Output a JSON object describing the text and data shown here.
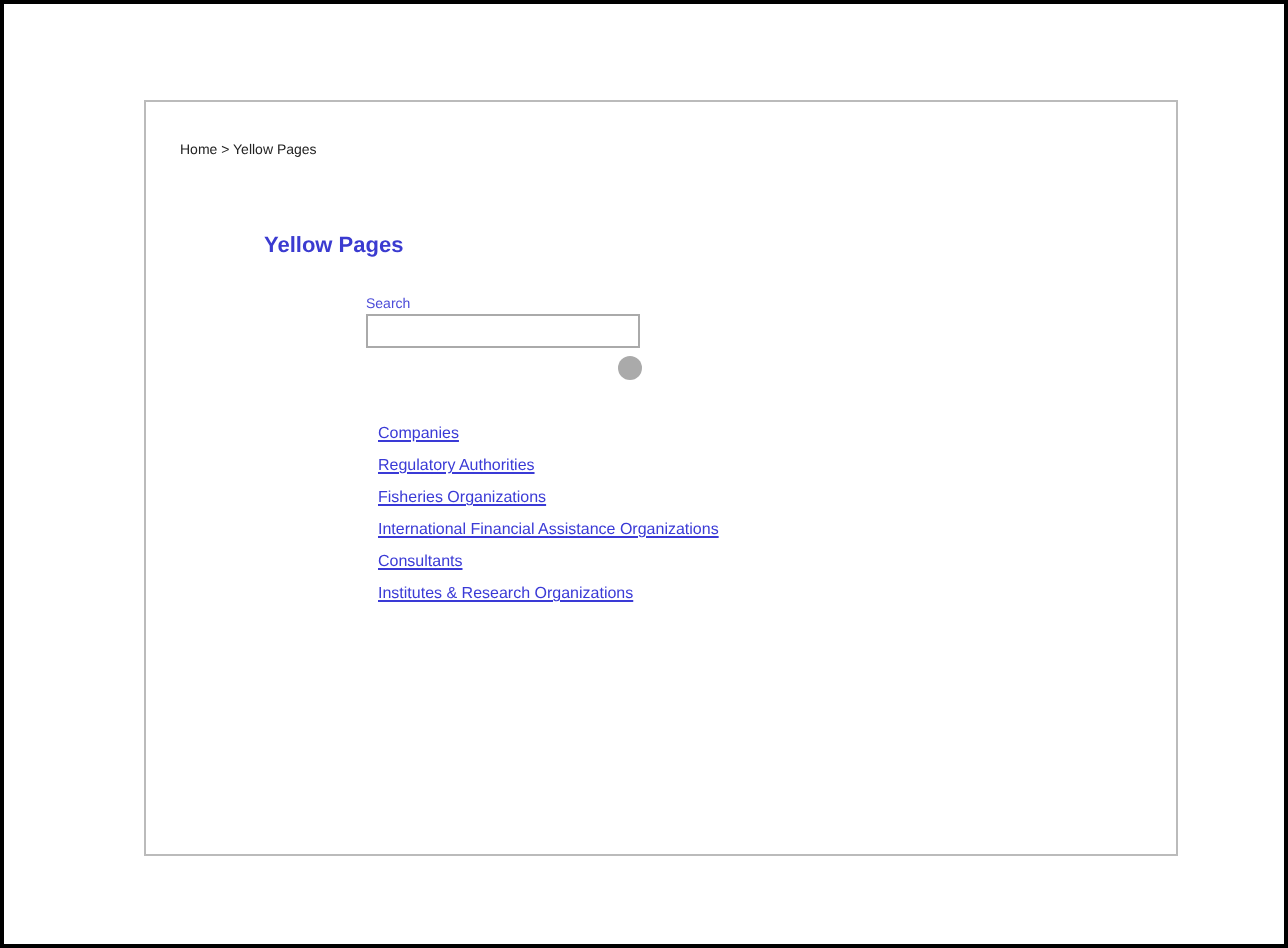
{
  "breadcrumb": "Home > Yellow Pages",
  "title": "Yellow Pages",
  "search": {
    "label": "Search"
  },
  "links": [
    "Companies",
    "Regulatory Authorities",
    "Fisheries Organizations",
    "International Financial Assistance Organizations",
    "Consultants",
    "Institutes & Research Organizations"
  ]
}
